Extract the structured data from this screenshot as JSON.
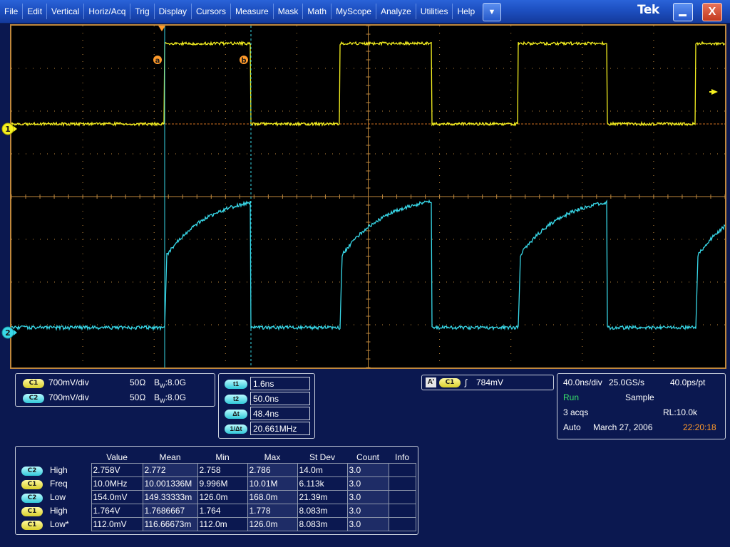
{
  "menu": {
    "items": [
      "File",
      "Edit",
      "Vertical",
      "Horiz/Acq",
      "Trig",
      "Display",
      "Cursors",
      "Measure",
      "Mask",
      "Math",
      "MyScope",
      "Analyze",
      "Utilities",
      "Help"
    ],
    "dropdown_glyph": "▼",
    "brand": "Tek",
    "minimize_icon": "minimize-icon",
    "close_glyph": "X"
  },
  "graticule": {
    "ch1_marker": "1",
    "ch2_marker": "2",
    "cursor_a_label": "a",
    "cursor_b_label": "b",
    "colors": {
      "ch1": "#f5f020",
      "ch2": "#38d8e8",
      "grid": "#c0883c",
      "cursor": "#38d8e8"
    }
  },
  "vertical": {
    "channels": [
      {
        "badge": "C1",
        "scale": "700mV/div",
        "impedance": "50Ω",
        "bw_prefix": "B",
        "bw_sub": "W",
        "bw_value": ":8.0G"
      },
      {
        "badge": "C2",
        "scale": "700mV/div",
        "impedance": "50Ω",
        "bw_prefix": "B",
        "bw_sub": "W",
        "bw_value": ":8.0G"
      }
    ]
  },
  "cursors": {
    "rows": [
      {
        "label": "t1",
        "value": "1.6ns"
      },
      {
        "label": "t2",
        "value": "50.0ns"
      },
      {
        "label": "Δt",
        "value": "48.4ns"
      },
      {
        "label": "1/Δt",
        "value": "20.661MHz"
      }
    ]
  },
  "trigger": {
    "source_badge": "A'",
    "channel_badge": "C1",
    "slope_glyph": "∫",
    "level": "784mV"
  },
  "acquisition": {
    "timebase": "40.0ns/div",
    "sample_rate": "25.0GS/s",
    "resolution": "40.0ps/pt",
    "state": "Run",
    "mode": "Sample",
    "acqs": "3 acqs",
    "record_length": "RL:10.0k",
    "trigger_mode": "Auto",
    "date": "March 27, 2006",
    "time": "22:20:18"
  },
  "measurements": {
    "headers": [
      "Value",
      "Mean",
      "Min",
      "Max",
      "St Dev",
      "Count",
      "Info"
    ],
    "rows": [
      {
        "badge": "C2",
        "name": "High",
        "value": "2.758V",
        "mean": "2.772",
        "min": "2.758",
        "max": "2.786",
        "stdev": "14.0m",
        "count": "3.0",
        "info": ""
      },
      {
        "badge": "C1",
        "name": "Freq",
        "value": "10.0MHz",
        "mean": "10.001336M",
        "min": "9.996M",
        "max": "10.01M",
        "stdev": "6.113k",
        "count": "3.0",
        "info": ""
      },
      {
        "badge": "C2",
        "name": "Low",
        "value": "154.0mV",
        "mean": "149.33333m",
        "min": "126.0m",
        "max": "168.0m",
        "stdev": "21.39m",
        "count": "3.0",
        "info": ""
      },
      {
        "badge": "C1",
        "name": "High",
        "value": "1.764V",
        "mean": "1.7686667",
        "min": "1.764",
        "max": "1.778",
        "stdev": "8.083m",
        "count": "3.0",
        "info": ""
      },
      {
        "badge": "C1",
        "name": "Low*",
        "value": "112.0mV",
        "mean": "116.66673m",
        "min": "112.0m",
        "max": "126.0m",
        "stdev": "8.083m",
        "count": "3.0",
        "info": ""
      }
    ]
  }
}
